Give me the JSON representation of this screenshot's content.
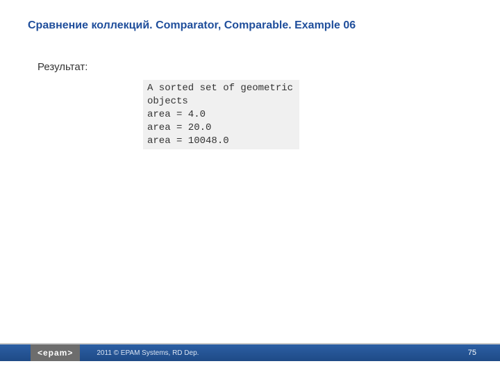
{
  "title": "Сравнение коллекций. Comparator, Comparable. Example 06",
  "result_label": "Результат:",
  "code_output": "A sorted set of geometric objects\narea = 4.0\narea = 20.0\narea = 10048.0",
  "footer": {
    "logo": "<epam>",
    "copyright": "2011 © EPAM Systems, RD Dep.",
    "page": "75"
  }
}
